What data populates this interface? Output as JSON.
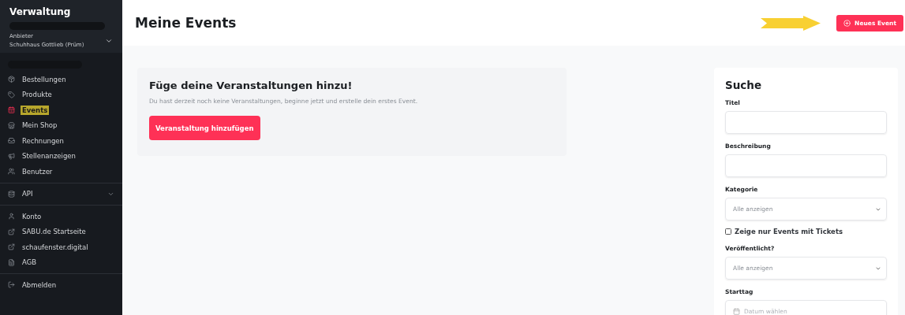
{
  "sidebar": {
    "title": "Verwaltung",
    "account": {
      "label": "Anbieter",
      "name": "Schuhhaus Gottlieb (Prüm)",
      "expanded": false
    },
    "groups": [
      {
        "items": [
          {
            "label": "Bestellungen",
            "selected": false
          },
          {
            "label": "Produkte",
            "selected": false
          },
          {
            "label": "Events",
            "selected": true
          },
          {
            "label": "Mein Shop",
            "selected": false
          },
          {
            "label": "Rechnungen",
            "selected": false
          },
          {
            "label": "Stellenanzeigen",
            "selected": false
          },
          {
            "label": "Benutzer",
            "selected": false
          }
        ]
      },
      {
        "items": [
          {
            "label": "API",
            "selected": false,
            "expanded": false
          }
        ]
      },
      {
        "items": [
          {
            "label": "Konto",
            "selected": false
          },
          {
            "label": "SABU.de Startseite",
            "selected": false
          },
          {
            "label": "schaufenster.digital",
            "selected": false
          },
          {
            "label": "AGB",
            "selected": false
          }
        ]
      },
      {
        "items": [
          {
            "label": "Abmelden",
            "selected": false
          }
        ]
      }
    ]
  },
  "header": {
    "title": "Meine Events",
    "button": "Neues Event"
  },
  "empty_card": {
    "title": "Füge deine Veranstaltungen hinzu!",
    "text": "Du hast derzeit noch keine Veranstaltungen, beginne jetzt und erstelle dein erstes Event.",
    "button": "Veranstaltung hinzufügen"
  },
  "search": {
    "title": "Suche",
    "fields": [
      {
        "kind": "text",
        "label": "Titel"
      },
      {
        "kind": "text",
        "label": "Beschreibung"
      },
      {
        "kind": "select",
        "label": "Kategorie",
        "value": "Alle anzeigen"
      },
      {
        "kind": "checkbox",
        "label": "Zeige nur Events mit Tickets",
        "checked": false
      },
      {
        "kind": "select",
        "label": "Veröffentlicht?",
        "value": "Alle anzeigen"
      },
      {
        "kind": "date",
        "label": "Starttag",
        "placeholder": "Datum wählen"
      }
    ]
  }
}
